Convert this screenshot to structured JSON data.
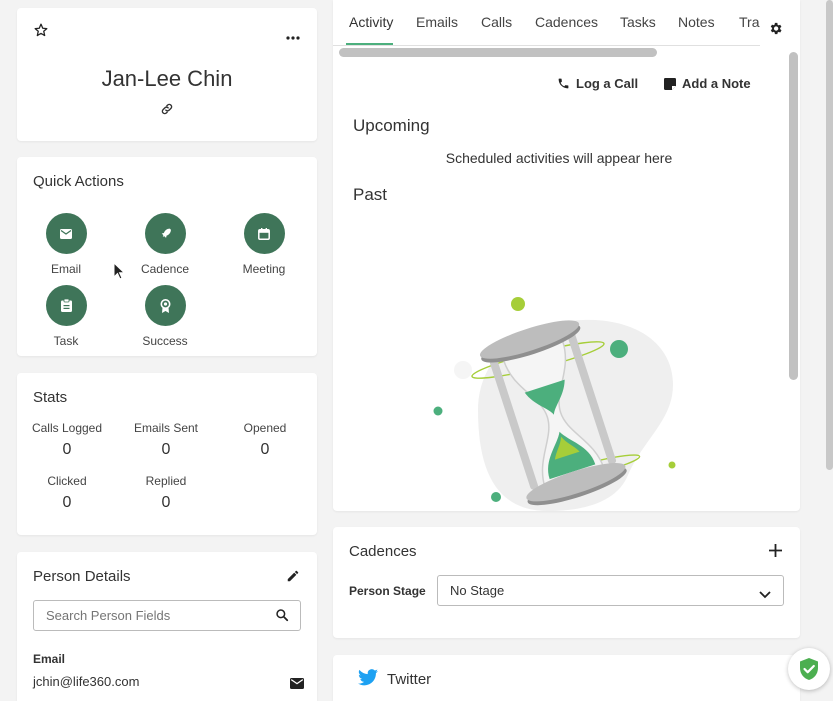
{
  "person": {
    "name": "Jan-Lee Chin"
  },
  "quick_actions": {
    "title": "Quick Actions",
    "items": [
      {
        "label": "Email",
        "icon": "mail-icon"
      },
      {
        "label": "Cadence",
        "icon": "rocket-icon"
      },
      {
        "label": "Meeting",
        "icon": "calendar-icon"
      },
      {
        "label": "Task",
        "icon": "clipboard-icon"
      },
      {
        "label": "Success",
        "icon": "award-icon"
      }
    ]
  },
  "stats": {
    "title": "Stats",
    "items": [
      {
        "label": "Calls Logged",
        "value": "0"
      },
      {
        "label": "Emails Sent",
        "value": "0"
      },
      {
        "label": "Opened",
        "value": "0"
      },
      {
        "label": "Clicked",
        "value": "0"
      },
      {
        "label": "Replied",
        "value": "0"
      }
    ]
  },
  "person_details": {
    "title": "Person Details",
    "search_placeholder": "Search Person Fields",
    "email_label": "Email",
    "email_value": "jchin@life360.com"
  },
  "activity": {
    "tabs": [
      "Activity",
      "Emails",
      "Calls",
      "Cadences",
      "Tasks",
      "Notes",
      "Trac"
    ],
    "active_tab": "Activity",
    "log_call": "Log a Call",
    "add_note": "Add a Note",
    "upcoming_title": "Upcoming",
    "upcoming_empty": "Scheduled activities will appear here",
    "past_title": "Past"
  },
  "cadences": {
    "title": "Cadences",
    "stage_label": "Person Stage",
    "stage_value": "No Stage"
  },
  "twitter": {
    "title": "Twitter"
  },
  "colors": {
    "accent": "#3f7559",
    "tab_underline": "#4caf7d",
    "twitter": "#1da1f2",
    "shield": "#4caf50"
  }
}
